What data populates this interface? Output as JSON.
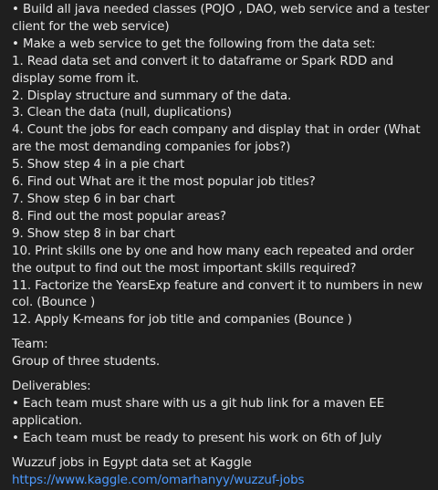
{
  "message": {
    "requirements": [
      "• Build all java needed classes (POJO , DAO, web service and a tester client for the web service)",
      "• Make a web service to get the following from the data set:",
      "1. Read data set and convert it to dataframe or Spark RDD and display some from it.",
      "2. Display structure and summary of the data.",
      "3. Clean the data (null, duplications)",
      "4. Count the jobs for each company and display that in order (What are the most demanding companies for jobs?)",
      "5. Show step 4 in a pie chart",
      "6. Find out What are it the most popular job titles?",
      "7. Show step 6 in bar chart",
      "8. Find out the most popular areas?",
      "9. Show step 8 in bar chart",
      "10. Print skills one by one and how many each repeated and order the output to find out the most important skills required?",
      "11. Factorize the YearsExp feature and convert it to numbers in new col. (Bounce )",
      "12. Apply K-means for job title and companies (Bounce )"
    ],
    "team_heading": "Team:",
    "team_text": "Group of three students.",
    "deliverables_heading": "Deliverables:",
    "deliverables": [
      "• Each team must share with us a git hub link for a maven EE application.",
      "• Each team must be ready to present his work on 6th of July"
    ],
    "dataset_title": "Wuzzuf jobs in Egypt data set at Kaggle",
    "dataset_link": "https://www.kaggle.com/omarhanyy/wuzzuf-jobs"
  },
  "colors": {
    "background": "#1f1f1f",
    "text": "#e6e6e6",
    "link": "#4c9aff"
  }
}
